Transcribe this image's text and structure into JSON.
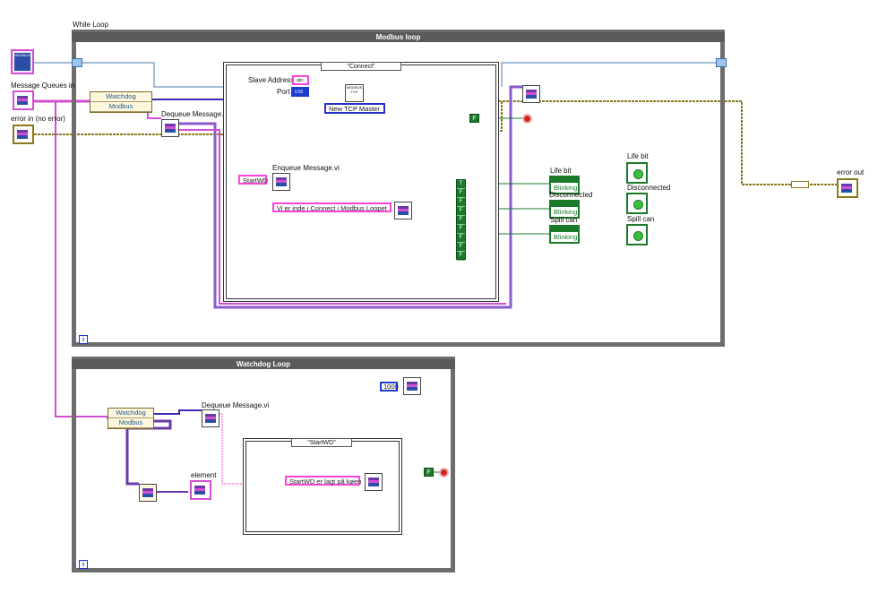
{
  "diagram": {
    "while_loop_label": "While Loop",
    "modbus_loop": {
      "title": "Modbus loop",
      "case_selector": "\"Connect\"",
      "slave_address_label": "Slave Address",
      "slave_address_type": "abc",
      "port_label": "Port",
      "port_type": "U16",
      "tcp_icon_text": "MODBUS TCP",
      "master_enum": "New TCP Master",
      "enqueue_label": "Enqueue Message.vi",
      "startwd_const": "StartWD",
      "message_const": "Vi er inde i Connect i Modbus Loopet",
      "dequeue_label": "Dequeue Message.vi",
      "unbundle_fields": [
        "Watchdog",
        "Modbus"
      ],
      "indicators": [
        {
          "label": "Life bit",
          "value": "Blinking"
        },
        {
          "label": "Disconnected",
          "value": "Blinking"
        },
        {
          "label": "Spill can",
          "value": "Blinking"
        }
      ],
      "leds": [
        "Life bit",
        "Disconnected",
        "Spill can"
      ],
      "bool_array_first": "T",
      "bool_array_rest": "F",
      "stop_const": "F",
      "iteration": "i"
    },
    "watchdog_loop": {
      "title": "Watchdog Loop",
      "wait_value": "1000",
      "dequeue_label": "Dequeue Message.vi",
      "unbundle_fields": [
        "Watchdog",
        "Modbus"
      ],
      "element_label": "element",
      "case_selector": "\"StartWD\"",
      "message_const": "StartWD er lagt på køen",
      "stop_const": "F",
      "iteration": "i"
    },
    "inputs": {
      "modbus_icon_text": "MODBUS",
      "message_queues_label": "Message Queues in",
      "error_in_label": "error in (no error)"
    },
    "outputs": {
      "error_out_label": "error out"
    },
    "colors": {
      "loop_border": "#6d6d6d",
      "cluster_wire": "#d24fd2",
      "error_wire": "#8b7a1a",
      "bool_wire": "#1a7a2a",
      "refnum_wire": "#3a2bb0",
      "annotation_circle": "#1b3fd0"
    }
  }
}
